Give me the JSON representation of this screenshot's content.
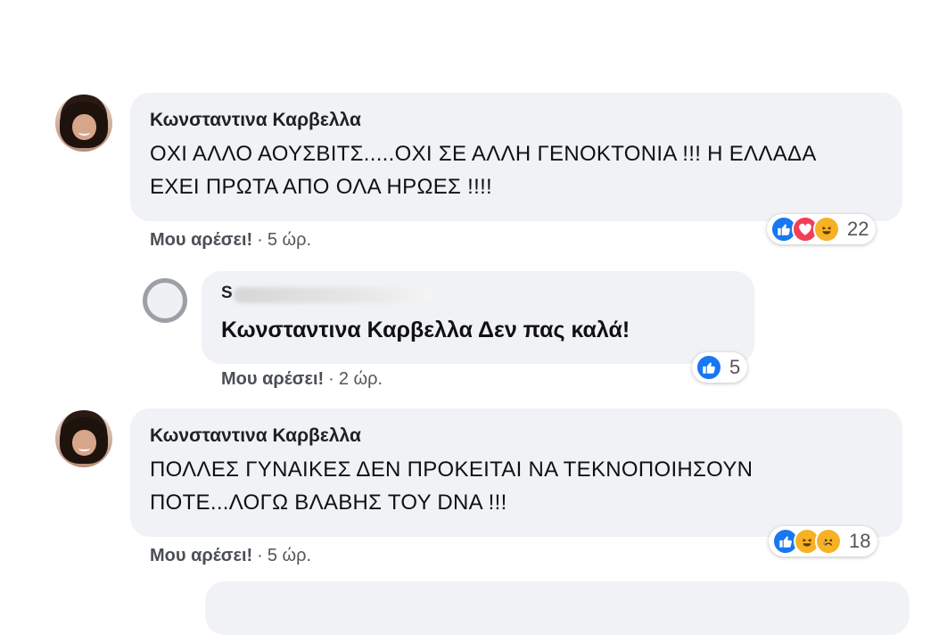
{
  "comments": [
    {
      "author": "Κωνσταντινα Καρβελλα",
      "text": "ΟΧΙ ΑΛΛΟ ΑΟΥΣΒΙΤΣ.....ΟΧΙ ΣΕ ΑΛΛΗ ΓΕΝΟΚΤΟΝΙΑ !!! Η ΕΛΛΑΔΑ ΕΧΕΙ ΠΡΩΤΑ ΑΠΟ ΟΛΑ ΗΡΩΕΣ !!!!",
      "like_label": "Μου αρέσει!",
      "dot": "·",
      "time": "5 ώρ.",
      "reaction_icons": [
        "like-icon",
        "love-icon",
        "haha-icon"
      ],
      "reaction_count": "22"
    },
    {
      "author": "Κωνσταντινα Καρβελλα",
      "text": "ΠΟΛΛΕΣ ΓΥΝΑΙΚΕΣ ΔΕΝ ΠΡΟΚΕΙΤΑΙ ΝΑ ΤΕΚΝΟΠΟΙΗΣΟΥΝ ΠΟΤΕ...ΛΟΓΩ ΒΛΑΒΗΣ ΤΟΥ DNA !!!",
      "like_label": "Μου αρέσει!",
      "dot": "·",
      "time": "5 ώρ.",
      "reaction_icons": [
        "like-icon",
        "haha-icon",
        "sad-icon"
      ],
      "reaction_count": "18"
    }
  ],
  "reply": {
    "author_initial": "S",
    "text": "Κωνσταντινα Καρβελλα Δεν πας καλά!",
    "like_label": "Μου αρέσει!",
    "dot": "·",
    "time": "2 ώρ.",
    "reaction_icons": [
      "like-icon"
    ],
    "reaction_count": "5"
  },
  "colors": {
    "bubble": "#f0f2f5",
    "like_blue": "#1877f2",
    "love_red": "#f33e58",
    "haha_yellow": "#f7b125"
  }
}
